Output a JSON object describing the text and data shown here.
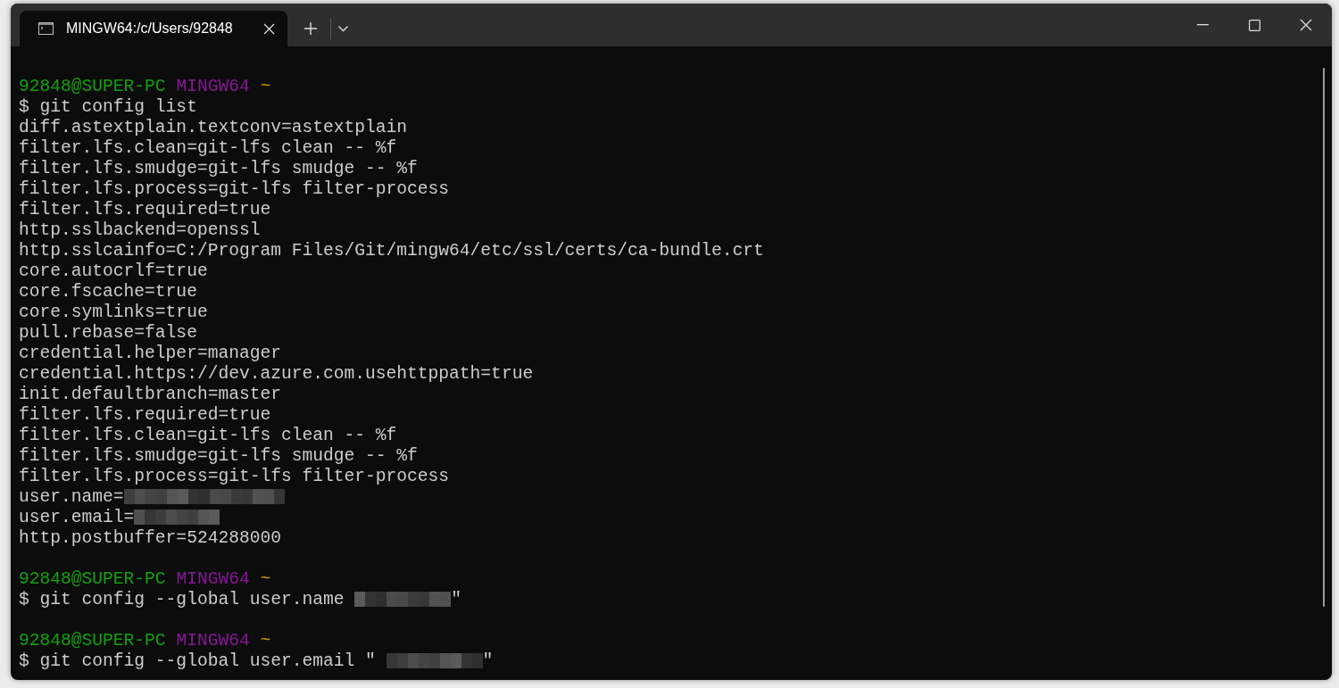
{
  "window": {
    "tab": {
      "title": "MINGW64:/c/Users/92848",
      "selected": true
    }
  },
  "terminal": {
    "lines": [
      {
        "kind": "prompt",
        "user_host": "92848@SUPER-PC",
        "shell": "MINGW64",
        "dir": "~"
      },
      {
        "kind": "command",
        "text": "$ git config list"
      },
      {
        "kind": "output",
        "text": "diff.astextplain.textconv=astextplain"
      },
      {
        "kind": "output",
        "text": "filter.lfs.clean=git-lfs clean -- %f"
      },
      {
        "kind": "output",
        "text": "filter.lfs.smudge=git-lfs smudge -- %f"
      },
      {
        "kind": "output",
        "text": "filter.lfs.process=git-lfs filter-process"
      },
      {
        "kind": "output",
        "text": "filter.lfs.required=true"
      },
      {
        "kind": "output",
        "text": "http.sslbackend=openssl"
      },
      {
        "kind": "output",
        "text": "http.sslcainfo=C:/Program Files/Git/mingw64/etc/ssl/certs/ca-bundle.crt"
      },
      {
        "kind": "output",
        "text": "core.autocrlf=true"
      },
      {
        "kind": "output",
        "text": "core.fscache=true"
      },
      {
        "kind": "output",
        "text": "core.symlinks=true"
      },
      {
        "kind": "output",
        "text": "pull.rebase=false"
      },
      {
        "kind": "output",
        "text": "credential.helper=manager"
      },
      {
        "kind": "output",
        "text": "credential.https://dev.azure.com.usehttppath=true"
      },
      {
        "kind": "output",
        "text": "init.defaultbranch=master"
      },
      {
        "kind": "output",
        "text": "filter.lfs.required=true"
      },
      {
        "kind": "output",
        "text": "filter.lfs.clean=git-lfs clean -- %f"
      },
      {
        "kind": "output",
        "text": "filter.lfs.smudge=git-lfs smudge -- %f"
      },
      {
        "kind": "output",
        "text": "filter.lfs.process=git-lfs filter-process"
      },
      {
        "kind": "output",
        "text": "user.name=",
        "redacted": true
      },
      {
        "kind": "output",
        "text": "user.email=",
        "redacted": true
      },
      {
        "kind": "output",
        "text": "http.postbuffer=524288000"
      },
      {
        "kind": "blank"
      },
      {
        "kind": "prompt",
        "user_host": "92848@SUPER-PC",
        "shell": "MINGW64",
        "dir": "~"
      },
      {
        "kind": "command",
        "text": "$ git config --global user.name",
        "redacted": true,
        "suffix": "\""
      },
      {
        "kind": "blank"
      },
      {
        "kind": "prompt",
        "user_host": "92848@SUPER-PC",
        "shell": "MINGW64",
        "dir": "~"
      },
      {
        "kind": "command",
        "text": "$ git config --global user.email \"",
        "redacted": true,
        "suffix": "\""
      }
    ]
  }
}
